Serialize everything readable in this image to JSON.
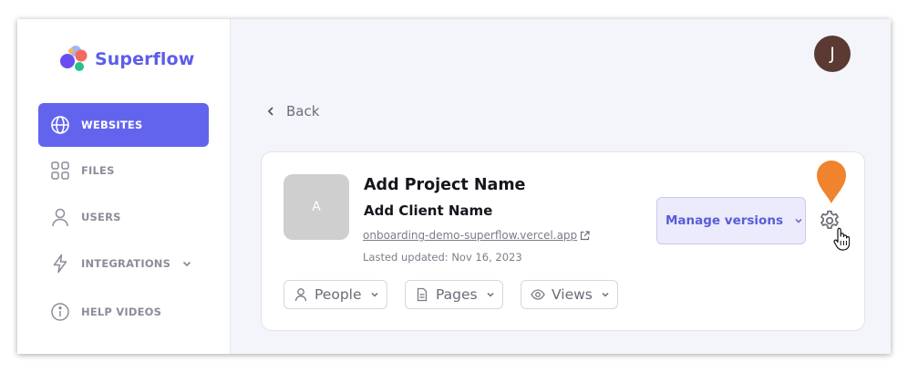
{
  "brand": {
    "name": "Superflow",
    "logo_icon": "superflow-logo-icon",
    "color": "#5c5ee8"
  },
  "sidebar": {
    "items": [
      {
        "label": "WEBSITES",
        "icon": "globe-icon",
        "active": true
      },
      {
        "label": "FILES",
        "icon": "grid-icon",
        "active": false
      },
      {
        "label": "USERS",
        "icon": "user-icon",
        "active": false
      },
      {
        "label": "INTEGRATIONS",
        "icon": "lightning-icon",
        "active": false,
        "has_dropdown": true
      },
      {
        "label": "HELP VIDEOS",
        "icon": "info-icon",
        "active": false
      }
    ],
    "accent": "#6364ee"
  },
  "header": {
    "avatar_initial": "J"
  },
  "back": {
    "label": "Back"
  },
  "project": {
    "thumbnail_letter": "A",
    "name": "Add Project Name",
    "client": "Add Client Name",
    "url": "onboarding-demo-superflow.vercel.app",
    "updated": "Lasted updated: Nov 16, 2023"
  },
  "actions": {
    "manage_versions": "Manage versions",
    "settings_icon": "gear-icon",
    "marker_color": "#f0832e"
  },
  "filters": [
    {
      "label": "People",
      "icon": "user-icon"
    },
    {
      "label": "Pages",
      "icon": "document-icon"
    },
    {
      "label": "Views",
      "icon": "eye-icon"
    }
  ]
}
